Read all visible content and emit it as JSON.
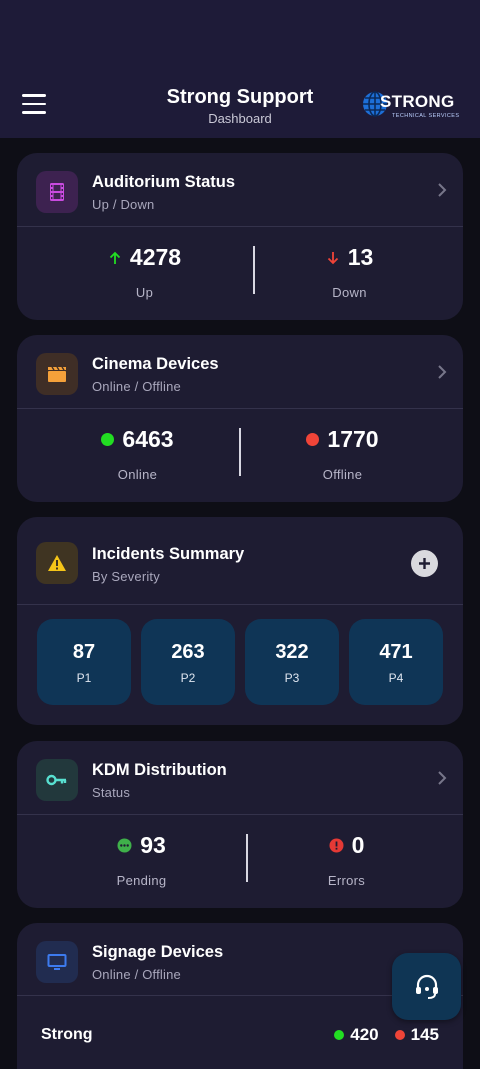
{
  "header": {
    "title": "Strong Support",
    "subtitle": "Dashboard",
    "logo_text": "STRONG",
    "logo_subtext": "TECHNICAL SERVICES"
  },
  "auditorium": {
    "title": "Auditorium Status",
    "subtitle": "Up / Down",
    "up_value": "4278",
    "up_label": "Up",
    "down_value": "13",
    "down_label": "Down"
  },
  "cinema": {
    "title": "Cinema Devices",
    "subtitle": "Online / Offline",
    "online_value": "6463",
    "online_label": "Online",
    "offline_value": "1770",
    "offline_label": "Offline"
  },
  "incidents": {
    "title": "Incidents Summary",
    "subtitle": "By Severity",
    "priorities": [
      {
        "value": "87",
        "label": "P1"
      },
      {
        "value": "263",
        "label": "P2"
      },
      {
        "value": "322",
        "label": "P3"
      },
      {
        "value": "471",
        "label": "P4"
      }
    ]
  },
  "kdm": {
    "title": "KDM Distribution",
    "subtitle": "Status",
    "pending_value": "93",
    "pending_label": "Pending",
    "errors_value": "0",
    "errors_label": "Errors"
  },
  "signage": {
    "title": "Signage Devices",
    "subtitle": "Online / Offline",
    "row_name": "Strong",
    "online_value": "420",
    "offline_value": "145"
  },
  "colors": {
    "header_bg": "#1e1b38",
    "card_bg": "#1e1c32",
    "green": "#22dd22",
    "red": "#f04438",
    "priority_bg": "#0f3556",
    "accent_purple": "#c94be0",
    "accent_orange": "#f5a13a",
    "accent_yellow": "#f5c518",
    "accent_teal": "#58e0d0",
    "accent_blue": "#3d7bef"
  },
  "icons": [
    "menu-icon",
    "film-icon",
    "clapperboard-icon",
    "warning-icon",
    "key-icon",
    "monitor-icon",
    "chevron-right-icon",
    "plus-icon",
    "arrow-up-icon",
    "arrow-down-icon",
    "support-headset-icon"
  ]
}
